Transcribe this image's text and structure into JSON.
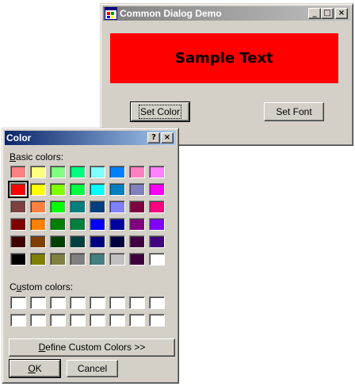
{
  "main_window": {
    "title": "Common Dialog Demo",
    "sample_text": "Sample Text",
    "sample_bg_color": "#ff0000",
    "set_color_label": "Set Color",
    "set_font_label": "Set Font",
    "window_buttons": {
      "minimize": "_",
      "maximize": "□",
      "close": "×"
    }
  },
  "color_dialog": {
    "title": "Color",
    "help_glyph": "?",
    "close_glyph": "×",
    "basic_colors_label": "Basic colors:",
    "custom_colors_label": "Custom colors:",
    "define_custom_label": "Define Custom Colors >>",
    "ok_label": "OK",
    "cancel_label": "Cancel",
    "selected_color": "#ff0000",
    "basic_colors": [
      [
        "#ff8080",
        "#ffff80",
        "#80ff80",
        "#00ff80",
        "#80ffff",
        "#0080ff",
        "#ff80c0",
        "#ff80ff"
      ],
      [
        "#ff0000",
        "#ffff00",
        "#80ff00",
        "#00ff40",
        "#00ffff",
        "#0080c0",
        "#8080c0",
        "#ff00ff"
      ],
      [
        "#804040",
        "#ff8040",
        "#00ff00",
        "#008080",
        "#004080",
        "#8080ff",
        "#800040",
        "#ff0080"
      ],
      [
        "#800000",
        "#ff8000",
        "#008000",
        "#008040",
        "#0000ff",
        "#0000a0",
        "#800080",
        "#8000ff"
      ],
      [
        "#400000",
        "#804000",
        "#004000",
        "#004040",
        "#000080",
        "#000040",
        "#400040",
        "#400080"
      ],
      [
        "#000000",
        "#808000",
        "#808040",
        "#808080",
        "#408080",
        "#c0c0c0",
        "#400040",
        "#ffffff"
      ]
    ],
    "custom_colors": [
      [
        "#ffffff",
        "#ffffff",
        "#ffffff",
        "#ffffff",
        "#ffffff",
        "#ffffff",
        "#ffffff",
        "#ffffff"
      ],
      [
        "#ffffff",
        "#ffffff",
        "#ffffff",
        "#ffffff",
        "#ffffff",
        "#ffffff",
        "#ffffff",
        "#ffffff"
      ]
    ]
  }
}
